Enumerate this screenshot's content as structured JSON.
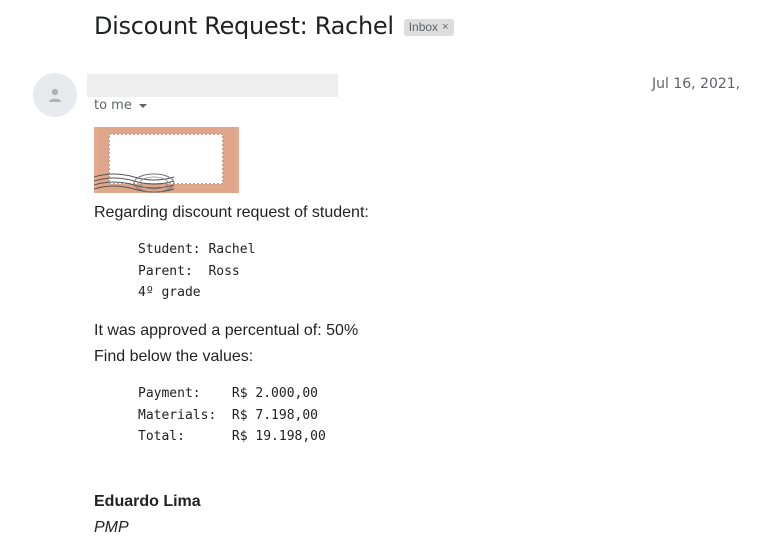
{
  "email": {
    "subject": "Discount Request: Rachel",
    "label": "Inbox",
    "label_remove": "×",
    "date": "Jul 16, 2021,",
    "recipient": "to me",
    "greeting": "Regarding discount request of student:",
    "student_info": [
      "Student: Rachel",
      "Parent:  Ross",
      "4º grade"
    ],
    "approval": "It was approved a percentual of: 50%",
    "values_intro": "Find below the values:",
    "values": [
      "Payment:    R$ 2.000,00",
      "Materials:  R$ 7.198,00",
      "Total:      R$ 19.198,00"
    ],
    "signature": {
      "name": "Eduardo Lima",
      "title": "PMP"
    }
  },
  "icons": {
    "avatar": "person-icon",
    "recipient_caret": "caret-down-icon",
    "stamp": "postage-stamp-image"
  },
  "colors": {
    "label_bg": "#dddddd",
    "muted_text": "#5f6368",
    "avatar_bg": "#e8eaed",
    "stamp_bg": "#e3ab90"
  }
}
